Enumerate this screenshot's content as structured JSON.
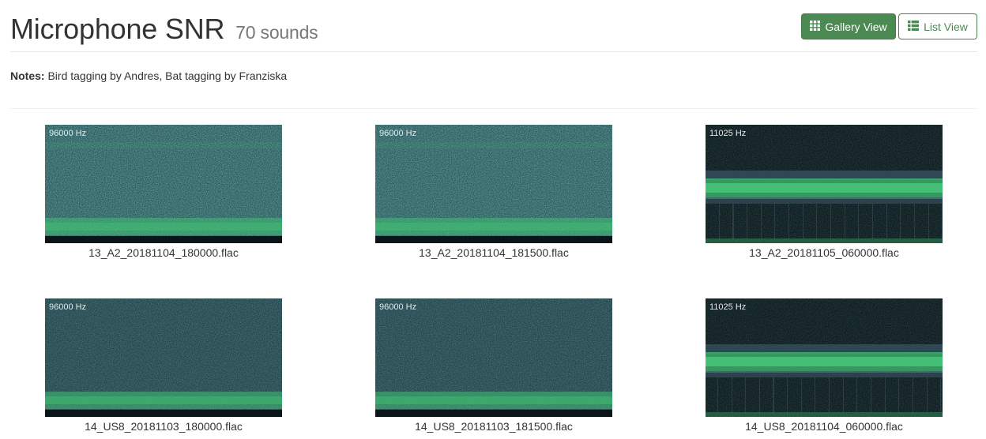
{
  "header": {
    "title": "Microphone SNR",
    "count": "70 sounds",
    "gallery_label": "Gallery View",
    "list_label": "List View"
  },
  "notes": {
    "label": "Notes:",
    "text": " Bird tagging by Andres, Bat tagging by Franziska"
  },
  "colors": {
    "accent": "#4c8a54",
    "spec_noise": "#2c5a63",
    "spec_signal": "#3fbf72",
    "spec_dark": "#0b1418"
  },
  "sounds": [
    {
      "rate": "96000 Hz",
      "file": "13_A2_20181104_180000.flac",
      "style": "hf"
    },
    {
      "rate": "96000 Hz",
      "file": "13_A2_20181104_181500.flac",
      "style": "hf"
    },
    {
      "rate": "11025 Hz",
      "file": "13_A2_20181105_060000.flac",
      "style": "lf"
    },
    {
      "rate": "96000 Hz",
      "file": "14_US8_20181103_180000.flac",
      "style": "hf2"
    },
    {
      "rate": "96000 Hz",
      "file": "14_US8_20181103_181500.flac",
      "style": "hf2"
    },
    {
      "rate": "11025 Hz",
      "file": "14_US8_20181104_060000.flac",
      "style": "lf"
    }
  ]
}
